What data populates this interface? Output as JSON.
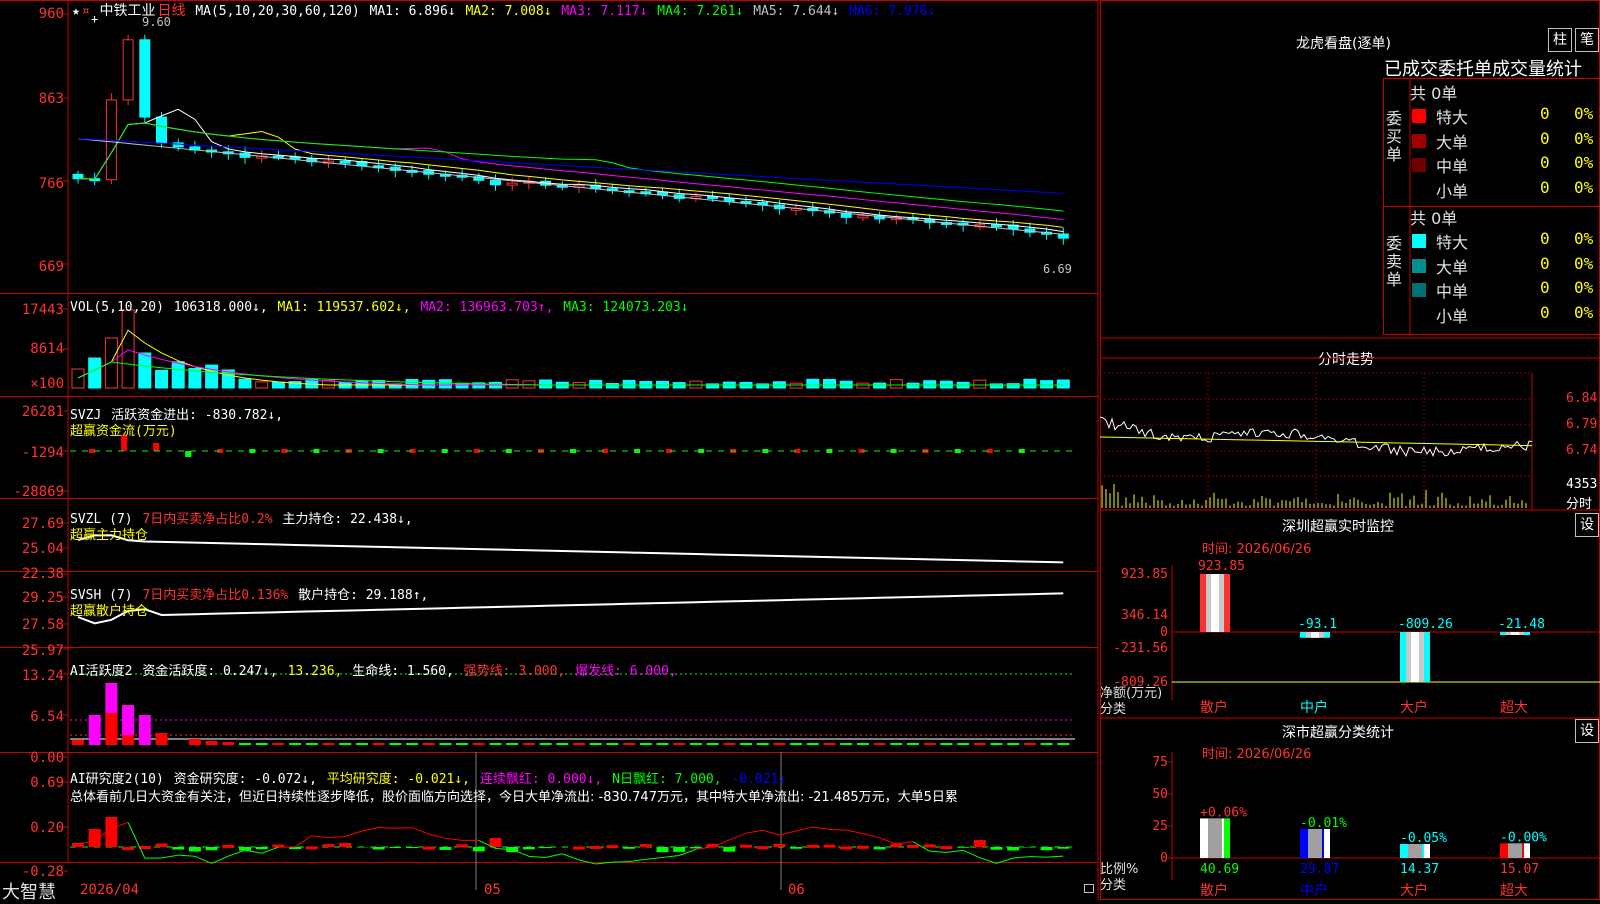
{
  "app": {
    "brand": "大智慧"
  },
  "stock": {
    "name": "中铁工业",
    "period": "日线",
    "price_high_label": "9.60",
    "price_low_label": "6.69"
  },
  "main_chart": {
    "ylabels": [
      "960",
      "863",
      "766",
      "669"
    ],
    "ma_header": {
      "title": "MA(5,10,20,30,60,120)",
      "ma1": "MA1: 6.896↓",
      "ma2": "MA2: 7.008↓",
      "ma3": "MA3: 7.117↓",
      "ma4": "MA4: 7.261↓",
      "ma5": "MA5: 7.644↓",
      "ma6": "MA6: 7.976↓"
    }
  },
  "vol_chart": {
    "ylabels": [
      "17443",
      "8614",
      "×100"
    ],
    "header": {
      "title": "VOL(5,10,20)",
      "val": "106318.000↓,",
      "ma1": "MA1: 119537.602↓,",
      "ma2": "MA2: 136963.703↑,",
      "ma3": "MA3: 124073.203↓"
    }
  },
  "svzj_chart": {
    "ylabels": [
      "26281",
      "-1294",
      "-28869"
    ],
    "header": {
      "title": "SVZJ",
      "label": "活跃资金进出: -830.782↓,",
      "sub": "超赢资金流(万元)"
    }
  },
  "svzl_chart": {
    "ylabels": [
      "27.69",
      "25.04",
      "22.38"
    ],
    "header": {
      "title": "SVZL (7)",
      "red": "7日内买卖净占比0.2%",
      "white": "主力持仓: 22.438↓,",
      "sub": "超赢主力持仓"
    }
  },
  "svsh_chart": {
    "ylabels": [
      "29.25",
      "27.58",
      "25.97"
    ],
    "header": {
      "title": "SVSH (7)",
      "red": "7日内买卖净占比0.136%",
      "white": "散户持仓: 29.188↑,",
      "sub": "超赢散户持仓"
    }
  },
  "ai_active_chart": {
    "ylabels": [
      "13.24",
      "6.54",
      "0.00"
    ],
    "header": {
      "title": "AI活跃度2",
      "white": "资金活跃度: 0.247↓,",
      "val2": "13.236,",
      "life": "生命线: 1.560,",
      "strong": "强势线: 3.000,",
      "burst": "爆发线: 6.000,"
    }
  },
  "ai_research_chart": {
    "ylabels": [
      "0.69",
      "0.20",
      "-0.28"
    ],
    "header": {
      "title": "AI研究度2(10)",
      "white": "资金研究度: -0.072↓,",
      "avg": "平均研究度: -0.021↓,",
      "cont": "连续飘红: 0.000↓,",
      "nday": "N日飘红: 7.000,",
      "nval": "-0.021↓"
    },
    "comment": "总体看前几日大资金有关注，但近日持续性逐步降低，股价面临方向选择，今日大单净流出: -830.747万元，其中特大单净流出: -21.485万元，大单5日累"
  },
  "date_axis": {
    "labels": [
      "2026/04",
      "05",
      "06"
    ]
  },
  "right_panel": {
    "dragon": {
      "title": "龙虎看盘(逐单)",
      "btn1": "柱",
      "btn2": "笔",
      "subtitle": "已成交委托单成交量统计"
    },
    "buy": {
      "label": "委买单",
      "total": "共 0单",
      "rows": [
        {
          "name": "特大",
          "val": "0",
          "pct": "0%",
          "color": "#ff0000"
        },
        {
          "name": "大单",
          "val": "0",
          "pct": "0%",
          "color": "#a00000"
        },
        {
          "name": "中单",
          "val": "0",
          "pct": "0%",
          "color": "#700000"
        },
        {
          "name": "小单",
          "val": "0",
          "pct": "0%",
          "color": "#000000"
        }
      ]
    },
    "sell": {
      "label": "委卖单",
      "total": "共 0单",
      "rows": [
        {
          "name": "特大",
          "val": "0",
          "pct": "0%",
          "color": "#00ffff"
        },
        {
          "name": "大单",
          "val": "0",
          "pct": "0%",
          "color": "#009090"
        },
        {
          "name": "中单",
          "val": "0",
          "pct": "0%",
          "color": "#007070"
        },
        {
          "name": "小单",
          "val": "0",
          "pct": "0%",
          "color": "#000000"
        }
      ]
    },
    "intraday": {
      "title": "分时走势",
      "ylabels": [
        "6.84",
        "6.79",
        "6.74"
      ],
      "vol_label": "4353",
      "vol_caption": "分时"
    },
    "monitor": {
      "title": "深圳超赢实时监控",
      "btn": "设",
      "time": "时间: 2026/06/26",
      "ylabels": [
        "923.85",
        "346.14",
        "0",
        "-231.56",
        "-809.26"
      ],
      "caption1": "净额(万元)",
      "caption2": "分类",
      "categories": [
        "散户",
        "中户",
        "大户",
        "超大"
      ],
      "values": [
        923.85,
        -93.1,
        -809.26,
        -21.48
      ],
      "value_labels": [
        "923.85",
        "-93.1",
        "-809.26",
        "-21.48"
      ]
    },
    "classify": {
      "title": "深市超赢分类统计",
      "btn": "设",
      "time": "时间: 2026/06/26",
      "ylabels": [
        "75",
        "50",
        "25",
        "0"
      ],
      "caption1": "比例%",
      "caption2": "分类",
      "categories": [
        "散户",
        "中户",
        "大户",
        "超大"
      ],
      "values": [
        40.69,
        29.87,
        14.37,
        15.07
      ],
      "value_labels": [
        "40.69",
        "29.87",
        "14.37",
        "15.07"
      ],
      "change_labels": [
        "+0.06%",
        "-0.01%",
        "-0.05%",
        "-0.00%"
      ]
    }
  },
  "colors": {
    "up": "#ff3232",
    "down": "#00ffff",
    "grid": "#c80000",
    "ma1": "#ffffff",
    "ma2": "#ffff00",
    "ma3": "#ff00ff",
    "ma4": "#00ff00",
    "ma5": "#c0c0c0",
    "ma6": "#0000ff"
  }
}
